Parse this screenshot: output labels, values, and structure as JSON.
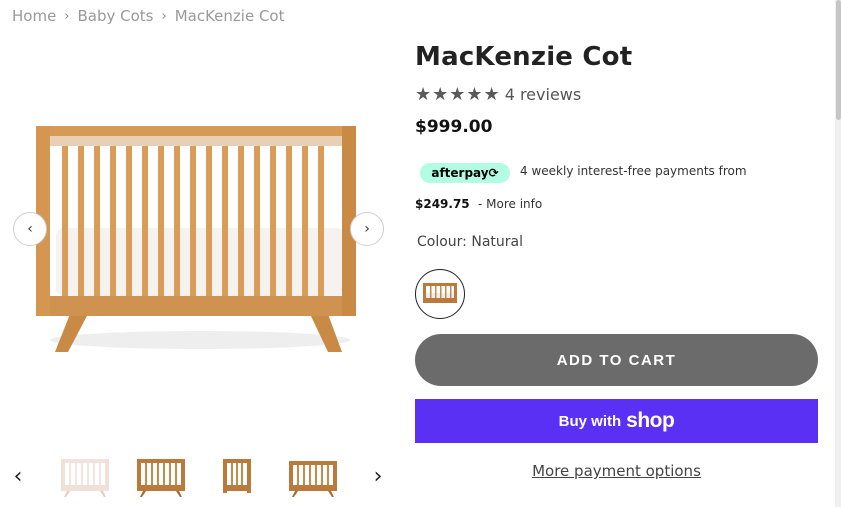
{
  "breadcrumb": {
    "items": [
      "Home",
      "Baby Cots",
      "MacKenzie Cot"
    ],
    "separator": "›"
  },
  "gallery": {
    "prev_icon": "‹",
    "next_icon": "›",
    "thumb_prev_icon": "‹",
    "thumb_next_icon": "›",
    "thumbnails": [
      "white cot",
      "natural cot",
      "cot side view",
      "cot front view"
    ]
  },
  "product": {
    "title": "MacKenzie Cot",
    "stars": "★★★★★",
    "reviews": "4 reviews",
    "price": "$999.00"
  },
  "afterpay": {
    "badge": "afterpay⟳",
    "text": "4 weekly interest-free payments from",
    "amount": "$249.75",
    "more_info": "- More info",
    "badge_color": "#b2fce4"
  },
  "colour": {
    "label": "Colour:",
    "value": "Natural"
  },
  "actions": {
    "add_to_cart": "ADD TO CART",
    "buy_with": "Buy with",
    "shop": "shop",
    "more_payment": "More payment options",
    "add_to_cart_color": "#6b6b6b",
    "shop_color": "#5a31f4"
  }
}
